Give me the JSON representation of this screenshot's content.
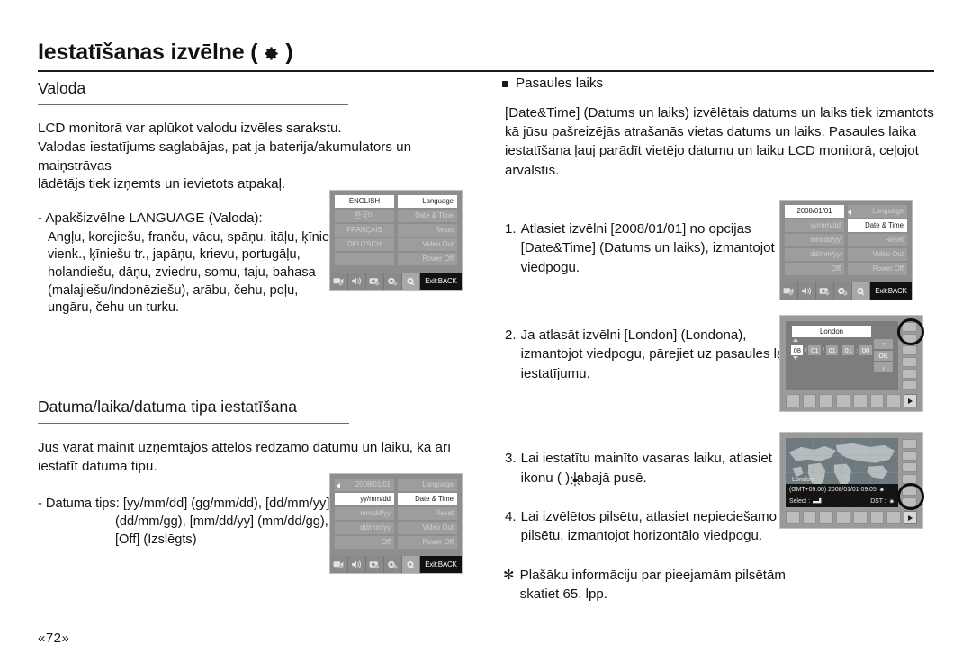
{
  "header": {
    "title": "Iestatīšanas izvēlne (",
    "title_close": ")",
    "gear_icon": "gear-icon"
  },
  "left": {
    "section1": {
      "heading": "Valoda",
      "para1_line1": "LCD monitorā var aplūkot valodu izvēles sarakstu.",
      "para1_line2": "Valodas iestatījums saglabājas, pat ja baterija/akumulators un maiņstrāvas",
      "para1_line3": "lādētājs tiek izņemts un ievietots atpakaļ.",
      "sub_label": "- Apakšizvēlne LANGUAGE (Valoda):",
      "sub_lines": [
        "Angļu, korejiešu, franču, vācu, spāņu, itāļu, ķīniešu",
        "vienk., ķīniešu tr., japāņu, krievu, portugāļu,",
        "holandiešu, dāņu, zviedru, somu, taju, bahasa",
        "(malajiešu/indonēziešu), arābu, čehu, poļu,",
        "ungāru, čehu un turku."
      ]
    },
    "section2": {
      "heading": "Datuma/laika/datuma tipa iestatīšana",
      "para1_line1": "Jūs varat mainīt uzņemtajos attēlos redzamo datumu un laiku, kā arī",
      "para1_line2": "iestatīt datuma tipu.",
      "sub_line1": "- Datuma tips: [yy/mm/dd] (gg/mm/dd), [dd/mm/yy]",
      "sub_line2": "(dd/mm/gg), [mm/dd/yy] (mm/dd/gg),",
      "sub_line3": "[Off] (Izslēgts)"
    }
  },
  "right": {
    "bullet_heading": "Pasaules laiks",
    "para_lines": [
      "[Date&Time] (Datums un laiks) izvēlētais datums un laiks tiek izmantots",
      "kā jūsu pašreizējās atrašanās vietas datums un laiks. Pasaules laika",
      "iestatīšana ļauj parādīt vietējo datumu un laiku LCD monitorā, ceļojot",
      "ārvalstīs."
    ],
    "steps": [
      {
        "num": "1.",
        "lines": [
          "Atlasiet izvēlni [2008/01/01] no opcijas",
          "[Date&Time] (Datums un laiks), izmantojot",
          "viedpogu."
        ]
      },
      {
        "num": "2.",
        "lines": [
          "Ja atlasāt izvēlni [London] (Londona),",
          "izmantojot viedpogu, pārejiet uz pasaules laika",
          "iestatījumu."
        ]
      },
      {
        "num": "3.",
        "lines": [
          "Lai iestatītu mainīto vasaras laiku, atlasiet",
          "ikonu (      ) labajā pusē."
        ]
      },
      {
        "num": "4.",
        "lines": [
          "Lai izvēlētos pilsētu, atlasiet nepieciešamo",
          "pilsētu,  izmantojot horizontālo viedpogu."
        ]
      }
    ],
    "note": {
      "marker": "✻",
      "lines": [
        "Plašāku informāciju par pieejamām pilsētām",
        "skatiet 65. lpp."
      ]
    }
  },
  "lcd_language": {
    "left_column": [
      "ENGLISH",
      "한국어",
      "FRANÇAIS",
      "DEUTSCH",
      "↓"
    ],
    "right_column": [
      "Language",
      "Date & Time",
      "Reset",
      "Video Out",
      "Power Off"
    ],
    "selected_left_index": 0,
    "selected_right_index": 0,
    "exit_label": "Exit:BACK",
    "icons": [
      "movie-icon",
      "sound-icon",
      "camera-setup-icon",
      "display-icon",
      "settings-gear-icon"
    ],
    "active_icon_index": 4
  },
  "lcd_datetype": {
    "left_column": [
      "2008/01/01",
      "yy/mm/dd",
      "mm/dd/yy",
      "dd/mm/yy",
      "Off"
    ],
    "right_column": [
      "Language",
      "Date & Time",
      "Reset",
      "Video Out",
      "Power Off"
    ],
    "selected_left_index": 1,
    "selected_right_index": 1,
    "exit_label": "Exit:BACK",
    "icons": [
      "movie-icon",
      "sound-icon",
      "camera-setup-icon",
      "display-icon",
      "settings-gear-icon"
    ],
    "active_icon_index": 4
  },
  "lcd_datetime_step1": {
    "left_column": [
      "2008/01/01",
      "yy/mm/dd",
      "mm/dd/yy",
      "dd/mm/yy",
      "Off"
    ],
    "right_column": [
      "Language",
      "Date & Time",
      "Reset",
      "Video Out",
      "Power Off"
    ],
    "selected_left_index": 0,
    "selected_right_index": 1,
    "exit_label": "Exit:BACK",
    "icons": [
      "movie-icon",
      "sound-icon",
      "camera-setup-icon",
      "display-icon",
      "settings-gear-icon"
    ],
    "active_icon_index": 4
  },
  "cam_london": {
    "city": "London",
    "fields": [
      "08",
      "01",
      "01",
      "01",
      "00"
    ],
    "sep_slash": "/",
    "sep_colon": ":",
    "ok_label": "OK",
    "up_arrow": "↑",
    "down_arrow": "↓"
  },
  "cam_map": {
    "city": "London",
    "info": "(GMT+09:00) 2008/01/01 09:05",
    "select_label": "Select :",
    "dst_label": "DST :",
    "sun_icon": "sun-icon"
  },
  "footer": {
    "page": "«72»"
  },
  "colors": {
    "page_bg": "#ffffff",
    "text": "#141414",
    "rule": "#1b1b1b",
    "lcd_bg": "#8e8e8e",
    "lcd_cell": "#9d9d9d",
    "lcd_selected": "#ffffff",
    "exit_bg": "#111111"
  }
}
